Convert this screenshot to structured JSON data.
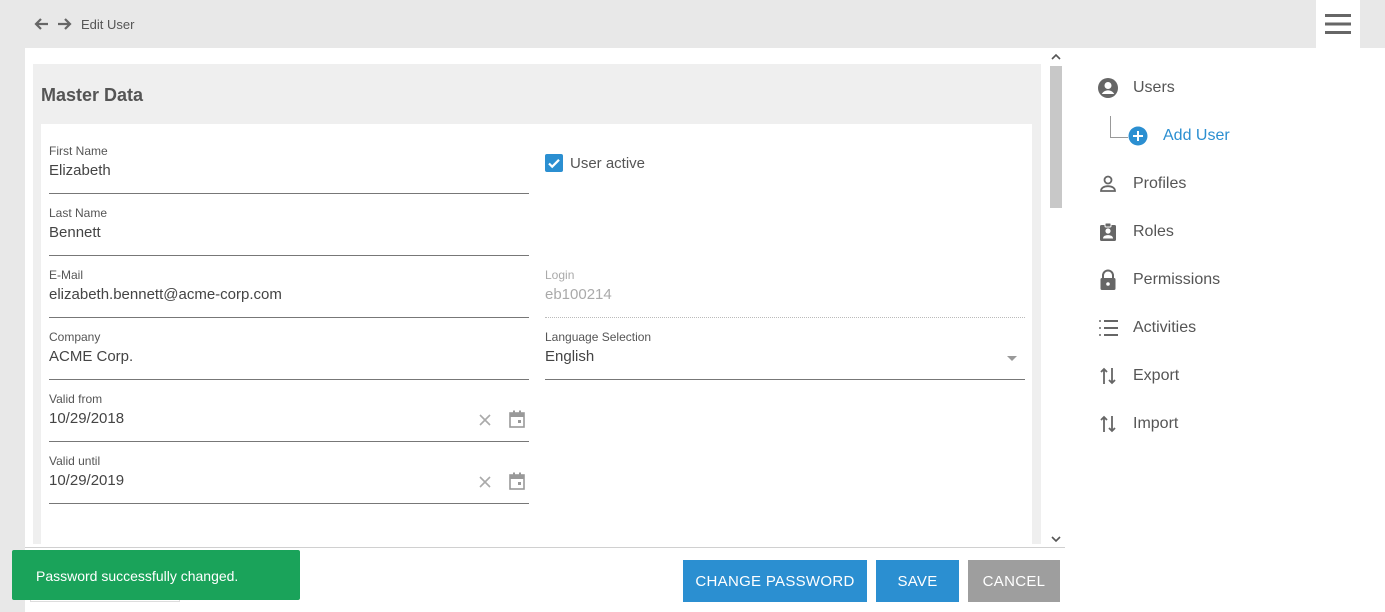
{
  "header": {
    "breadcrumb": "Edit User",
    "back_icon": "arrow-left-icon",
    "forward_icon": "arrow-right-icon",
    "menu_icon": "hamburger-icon"
  },
  "section": {
    "title": "Master Data"
  },
  "form": {
    "first_name": {
      "label": "First Name",
      "value": "Elizabeth"
    },
    "last_name": {
      "label": "Last Name",
      "value": "Bennett"
    },
    "email": {
      "label": "E-Mail",
      "value": "elizabeth.bennett@acme-corp.com"
    },
    "company": {
      "label": "Company",
      "value": "ACME Corp."
    },
    "valid_from": {
      "label": "Valid from",
      "value": "10/29/2018"
    },
    "valid_until": {
      "label": "Valid until",
      "value": "10/29/2019"
    },
    "user_active": {
      "label": "User active",
      "checked": true
    },
    "login": {
      "label": "Login",
      "value": "eb100214"
    },
    "language": {
      "label": "Language Selection",
      "value": "English"
    }
  },
  "buttons": {
    "change_password": "CHANGE PASSWORD",
    "save": "SAVE",
    "cancel": "CANCEL"
  },
  "toast": {
    "message": "Password successfully changed."
  },
  "sidebar": {
    "items": [
      {
        "label": "Users",
        "icon": "user-circle-icon"
      },
      {
        "label": "Add User",
        "icon": "plus-circle-icon"
      },
      {
        "label": "Profiles",
        "icon": "person-icon"
      },
      {
        "label": "Roles",
        "icon": "badge-icon"
      },
      {
        "label": "Permissions",
        "icon": "lock-icon"
      },
      {
        "label": "Activities",
        "icon": "list-icon"
      },
      {
        "label": "Export",
        "icon": "swap-vertical-icon"
      },
      {
        "label": "Import",
        "icon": "swap-vertical-icon"
      }
    ]
  },
  "colors": {
    "accent": "#2b8fd1",
    "toast": "#1aa35a",
    "cancel": "#9e9e9e"
  }
}
